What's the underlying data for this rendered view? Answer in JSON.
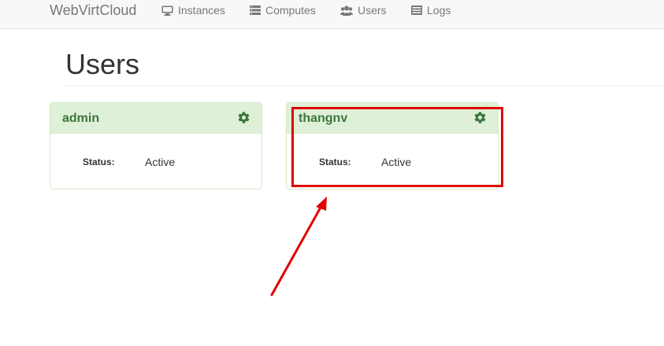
{
  "navbar": {
    "brand": "WebVirtCloud",
    "items": [
      {
        "label": "Instances",
        "icon": "monitor-icon"
      },
      {
        "label": "Computes",
        "icon": "server-icon"
      },
      {
        "label": "Users",
        "icon": "users-icon"
      },
      {
        "label": "Logs",
        "icon": "list-icon"
      }
    ]
  },
  "page": {
    "title": "Users"
  },
  "users": [
    {
      "name": "admin",
      "status_label": "Status:",
      "status_value": "Active"
    },
    {
      "name": "thangnv",
      "status_label": "Status:",
      "status_value": "Active"
    }
  ],
  "colors": {
    "panel_heading_bg": "#dff0d8",
    "panel_border": "#d6e9c6",
    "panel_title": "#3c763d",
    "annotation_red": "#e00000"
  }
}
